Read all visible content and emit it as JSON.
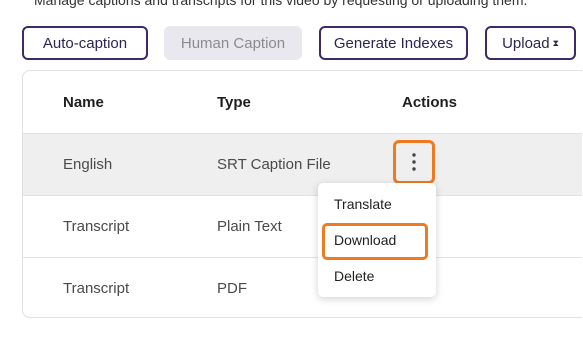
{
  "intro_text": "Manage captions and transcripts for this video by requesting or uploading them.",
  "toolbar": {
    "auto_caption": "Auto-caption",
    "human_caption": "Human Caption",
    "generate_indexes": "Generate Indexes",
    "upload": "Upload",
    "upload_caret": "⧗"
  },
  "table": {
    "headers": {
      "name": "Name",
      "type": "Type",
      "actions": "Actions"
    },
    "rows": [
      {
        "name": "English",
        "type": "SRT Caption File"
      },
      {
        "name": "Transcript",
        "type": "Plain Text"
      },
      {
        "name": "Transcript",
        "type": "PDF"
      }
    ]
  },
  "menu": {
    "translate": "Translate",
    "download": "Download",
    "delete": "Delete"
  },
  "colors": {
    "accent_border": "#3d2a66",
    "highlight": "#ee7a22",
    "disabled_bg": "#e9e8ee",
    "selected_row_bg": "#efefef"
  },
  "icons": {
    "actions": "kebab-menu-icon"
  }
}
